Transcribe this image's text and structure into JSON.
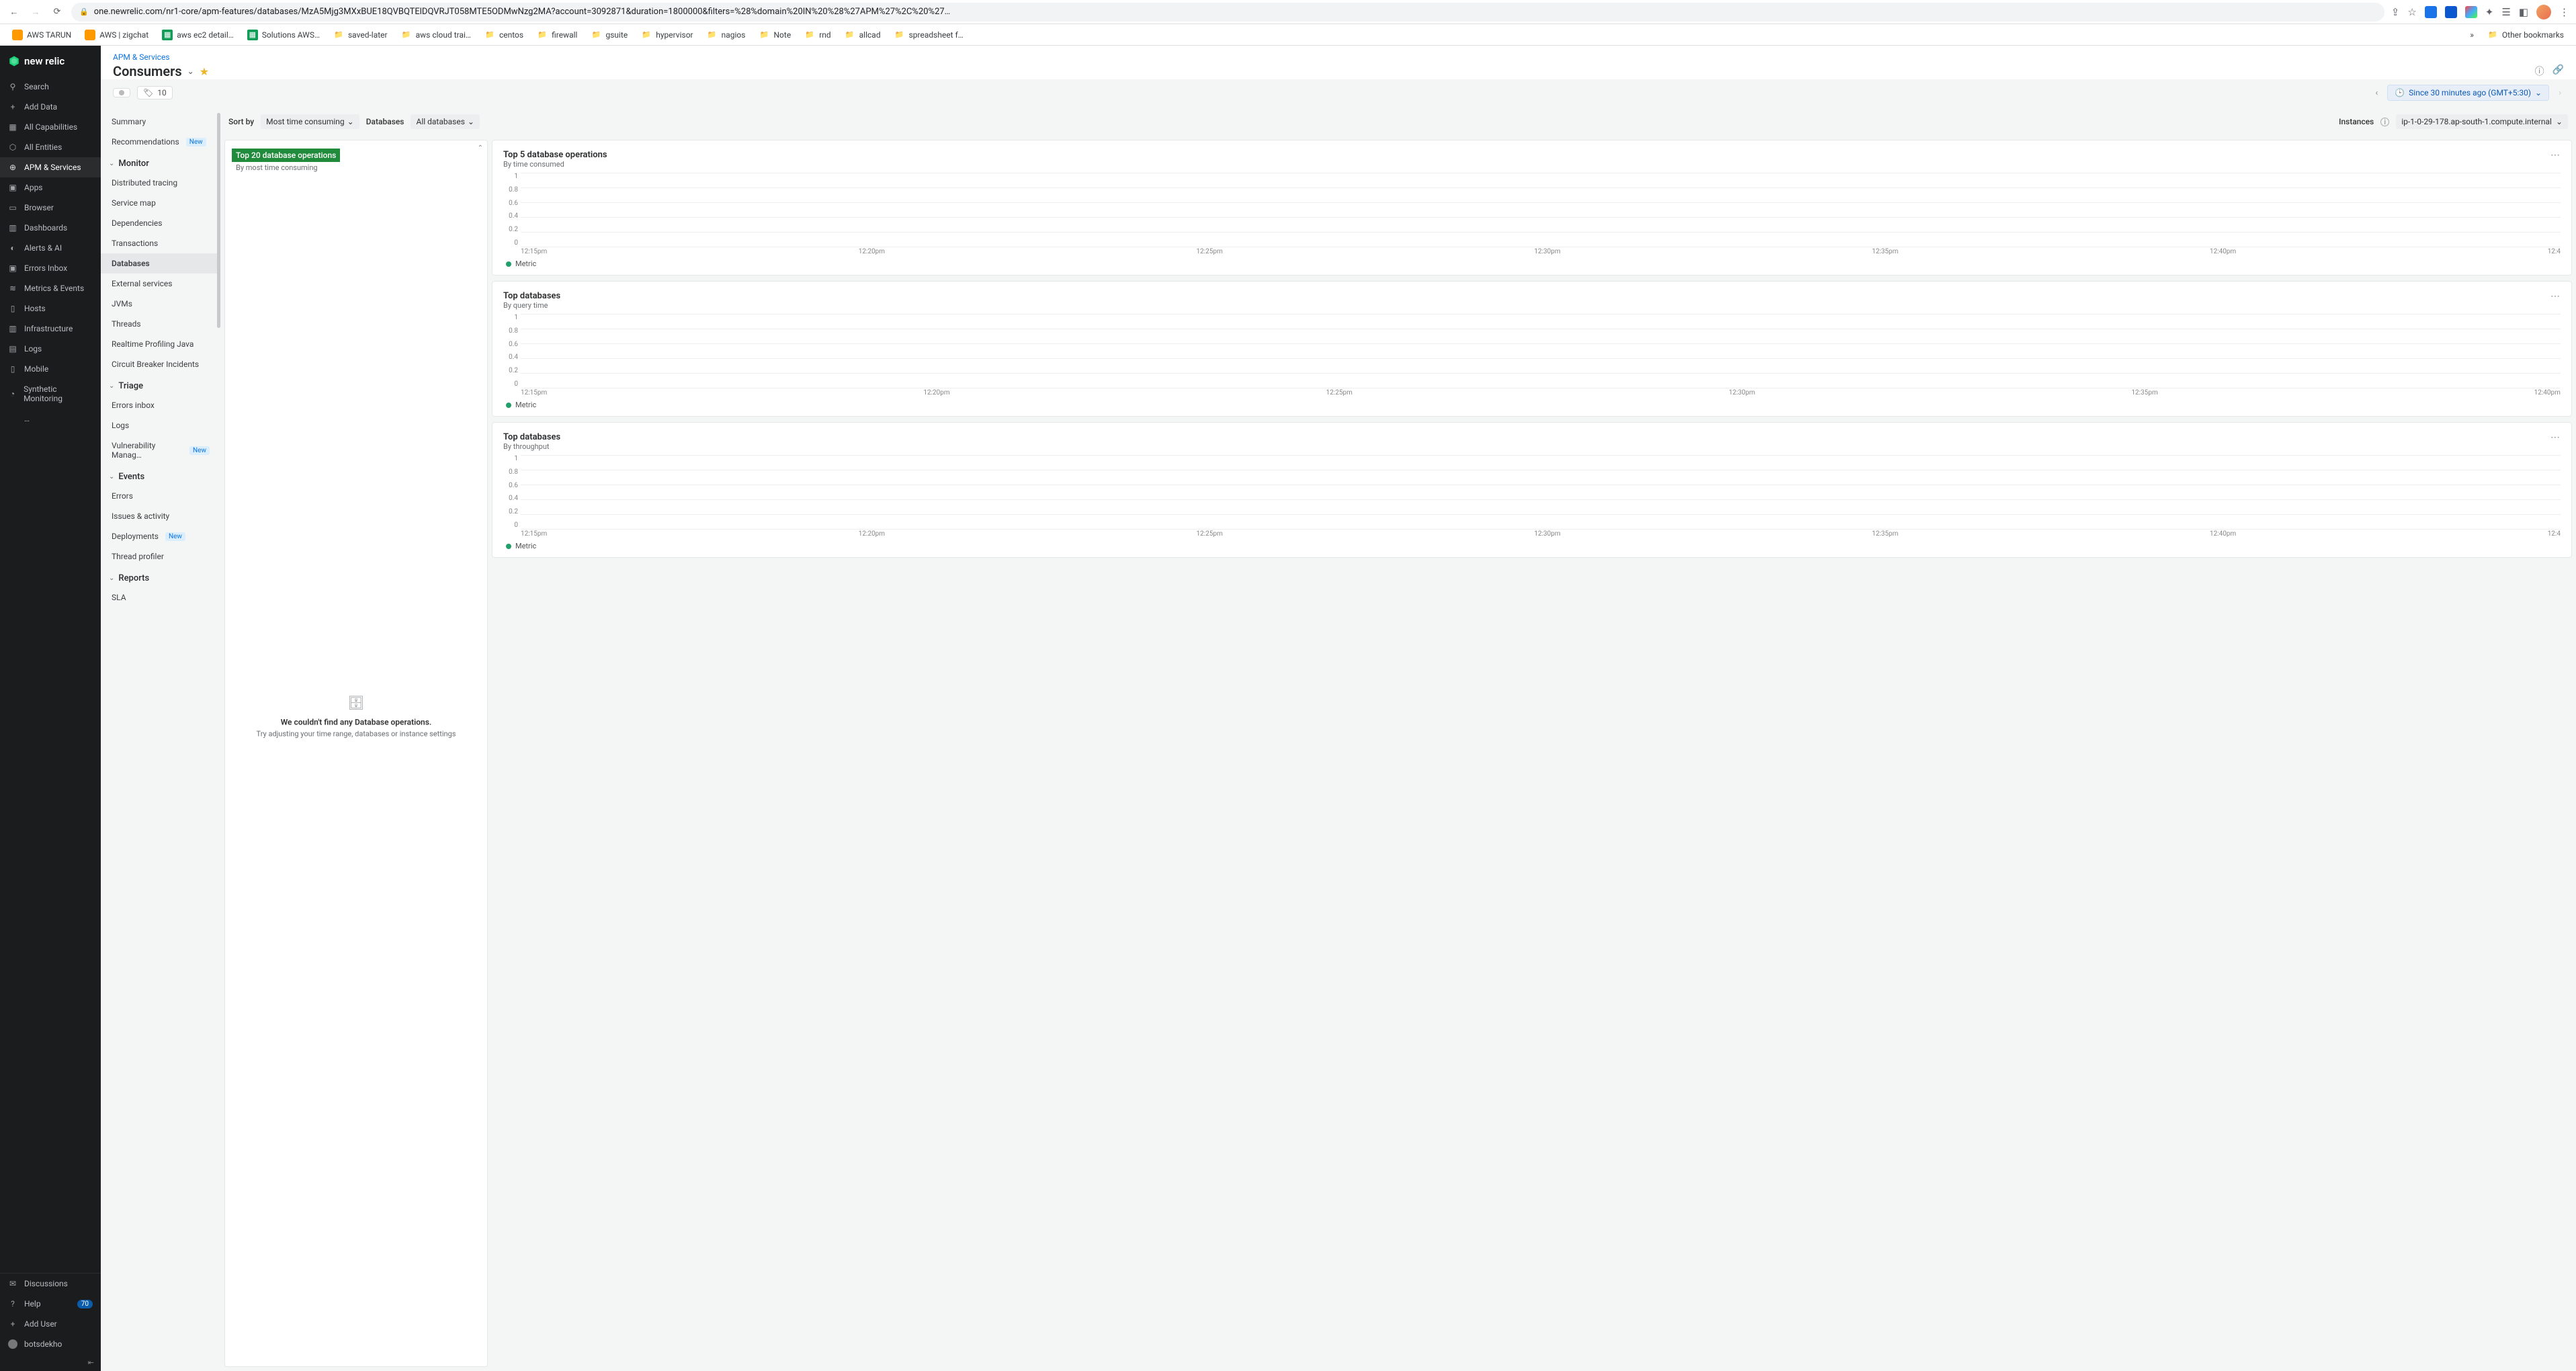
{
  "browser": {
    "url": "one.newrelic.com/nr1-core/apm-features/databases/MzA5Mjg3MXxBUE18QVBQTElDQVRJT058MTE5ODMwNzg2MA?account=3092871&duration=1800000&filters=%28%domain%20IN%20%28%27APM%27%2C%20%27…"
  },
  "bookmarks": [
    {
      "label": "AWS TARUN",
      "type": "aws"
    },
    {
      "label": "AWS | zigchat",
      "type": "aws"
    },
    {
      "label": "aws ec2 detail…",
      "type": "sheet"
    },
    {
      "label": "Solutions AWS…",
      "type": "sheet"
    },
    {
      "label": "saved-later",
      "type": "folder"
    },
    {
      "label": "aws cloud trai…",
      "type": "folder"
    },
    {
      "label": "centos",
      "type": "folder"
    },
    {
      "label": "firewall",
      "type": "folder"
    },
    {
      "label": "gsuite",
      "type": "folder"
    },
    {
      "label": "hypervisor",
      "type": "folder"
    },
    {
      "label": "nagios",
      "type": "folder"
    },
    {
      "label": "Note",
      "type": "folder"
    },
    {
      "label": "rnd",
      "type": "folder"
    },
    {
      "label": "allcad",
      "type": "folder"
    },
    {
      "label": "spreadsheet f…",
      "type": "folder"
    }
  ],
  "other_bookmarks": "Other bookmarks",
  "logo": "new relic",
  "leftnav": {
    "top": [
      {
        "label": "Search",
        "icon": "⚲"
      },
      {
        "label": "Add Data",
        "icon": "+"
      },
      {
        "label": "All Capabilities",
        "icon": "▦"
      },
      {
        "label": "All Entities",
        "icon": "⬡"
      },
      {
        "label": "APM & Services",
        "icon": "⊕",
        "active": true
      },
      {
        "label": "Apps",
        "icon": "▣"
      },
      {
        "label": "Browser",
        "icon": "▭"
      },
      {
        "label": "Dashboards",
        "icon": "▥"
      },
      {
        "label": "Alerts & AI",
        "icon": "◐"
      },
      {
        "label": "Errors Inbox",
        "icon": "▣"
      },
      {
        "label": "Metrics & Events",
        "icon": "≋"
      },
      {
        "label": "Hosts",
        "icon": "▯"
      },
      {
        "label": "Infrastructure",
        "icon": "▥"
      },
      {
        "label": "Logs",
        "icon": "▤"
      },
      {
        "label": "Mobile",
        "icon": "▯"
      },
      {
        "label": "Synthetic Monitoring",
        "icon": "◔"
      },
      {
        "label": "…",
        "icon": ""
      }
    ],
    "bottom": [
      {
        "label": "Discussions",
        "icon": "✉"
      },
      {
        "label": "Help",
        "icon": "?",
        "badge": "70"
      },
      {
        "label": "Add User",
        "icon": "+"
      },
      {
        "label": "botsdekho",
        "icon": "avatar"
      }
    ]
  },
  "header": {
    "breadcrumb": "APM & Services",
    "title": "Consumers",
    "tag_count": "10",
    "time_range": "Since 30 minutes ago (GMT+5:30)"
  },
  "secondary_nav": {
    "top": [
      {
        "label": "Summary"
      },
      {
        "label": "Recommendations",
        "new": true
      }
    ],
    "groups": [
      {
        "title": "Monitor",
        "items": [
          {
            "label": "Distributed tracing"
          },
          {
            "label": "Service map"
          },
          {
            "label": "Dependencies"
          },
          {
            "label": "Transactions"
          },
          {
            "label": "Databases",
            "selected": true
          },
          {
            "label": "External services"
          },
          {
            "label": "JVMs"
          },
          {
            "label": "Threads"
          },
          {
            "label": "Realtime Profiling Java"
          },
          {
            "label": "Circuit Breaker Incidents"
          }
        ]
      },
      {
        "title": "Triage",
        "items": [
          {
            "label": "Errors inbox"
          },
          {
            "label": "Logs"
          },
          {
            "label": "Vulnerability Manag…",
            "new": true
          }
        ]
      },
      {
        "title": "Events",
        "items": [
          {
            "label": "Errors"
          },
          {
            "label": "Issues & activity"
          },
          {
            "label": "Deployments",
            "new": true
          },
          {
            "label": "Thread profiler"
          }
        ]
      },
      {
        "title": "Reports",
        "items": [
          {
            "label": "SLA"
          }
        ]
      }
    ]
  },
  "filters": {
    "sort_by_label": "Sort by",
    "sort_value": "Most time consuming",
    "db_label": "Databases",
    "db_value": "All databases",
    "instances_label": "Instances",
    "instance_value": "ip-1-0-29-178.ap-south-1.compute.internal"
  },
  "left_panel": {
    "selected_title": "Top 20 database operations",
    "selected_sub": "By most time consuming",
    "empty_title": "We couldn't find any Database operations.",
    "empty_sub": "Try adjusting your time range, databases or instance settings"
  },
  "charts": [
    {
      "title": "Top 5 database operations",
      "subtitle": "By time consumed",
      "xticks": [
        "12:15pm",
        "12:20pm",
        "12:25pm",
        "12:30pm",
        "12:35pm",
        "12:40pm",
        "12:4"
      ],
      "legend": "Metric"
    },
    {
      "title": "Top databases",
      "subtitle": "By query time",
      "xticks": [
        "12:15pm",
        "12:20pm",
        "12:25pm",
        "12:30pm",
        "12:35pm",
        "12:40pm"
      ],
      "legend": "Metric"
    },
    {
      "title": "Top databases",
      "subtitle": "By throughput",
      "xticks": [
        "12:15pm",
        "12:20pm",
        "12:25pm",
        "12:30pm",
        "12:35pm",
        "12:40pm",
        "12:4"
      ],
      "legend": "Metric"
    }
  ],
  "chart_data": {
    "type": "line",
    "series": [
      {
        "name": "Metric",
        "values": []
      }
    ],
    "yticks": [
      1,
      0.8,
      0.6,
      0.4,
      0.2,
      0
    ],
    "ylim": [
      0,
      1
    ],
    "note": "No data — empty charts"
  }
}
